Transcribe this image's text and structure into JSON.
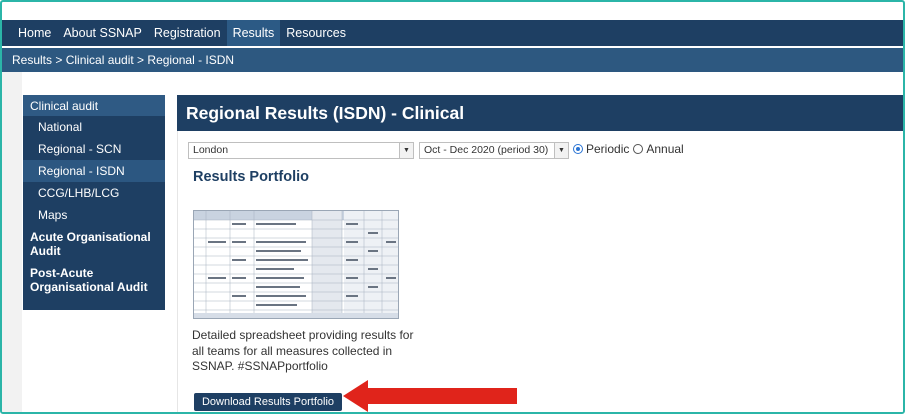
{
  "topnav": {
    "items": [
      "Home",
      "About SSNAP",
      "Registration",
      "Results",
      "Resources"
    ],
    "active_index": 3
  },
  "breadcrumb": "Results > Clinical audit > Regional - ISDN",
  "sidebar": {
    "head": "Clinical audit",
    "items": [
      "National",
      "Regional - SCN",
      "Regional - ISDN",
      "CCG/LHB/LCG",
      "Maps"
    ],
    "active": "Regional - ISDN",
    "sections": [
      "Acute Organisational Audit",
      "Post-Acute Organisational Audit"
    ]
  },
  "main": {
    "title": "Regional Results (ISDN) - Clinical",
    "region_select": "London",
    "period_select": "Oct - Dec 2020 (period 30)",
    "radio_periodic": "Periodic",
    "radio_annual": "Annual",
    "radio_selected": "Periodic",
    "portfolio_title": "Results Portfolio",
    "description": "Detailed spreadsheet providing results for all teams for all measures collected in SSNAP. #SSNAPportfolio",
    "download_button": "Download Results Portfolio"
  },
  "icons": [
    "dropdown-arrow-icon",
    "red-arrow-icon",
    "spreadsheet-thumbnail"
  ],
  "colors": {
    "nav": "#1e3f63",
    "breadcrumb": "#2d5880",
    "accent_arrow": "#e0241b",
    "frame_border": "#2bb5a8"
  }
}
